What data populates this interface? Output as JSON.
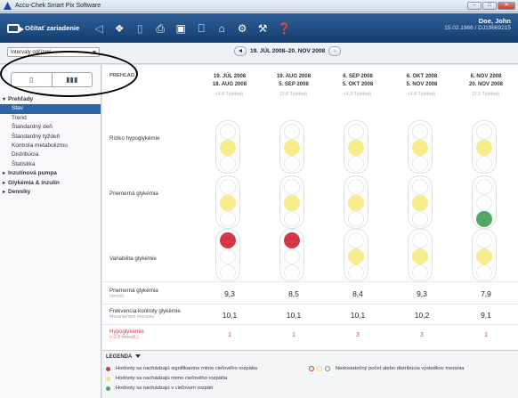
{
  "window": {
    "title": "Accu-Chek Smart Pix Software",
    "controls": [
      "–",
      "□",
      "✕"
    ]
  },
  "toolbar": {
    "read_label": "Očítať zariadenie",
    "icons": [
      "◁",
      "❖",
      "▯",
      "⎙",
      "▣",
      "⎕",
      "⌂",
      "⚙",
      "⚒",
      "❓"
    ]
  },
  "user": {
    "name": "Doe, John",
    "dob_id": "15.02.1966 / DJ19669215"
  },
  "subbar": {
    "interval_select": "Intervaly odčítaní",
    "date_range": "19. JÚL 2008–20. NOV 2008"
  },
  "view_toggle": {
    "left": "▯",
    "right": "▮▮▮"
  },
  "sidebar": {
    "items": [
      {
        "label": "Prehľady",
        "type": "group-open"
      },
      {
        "label": "Stav",
        "type": "item",
        "selected": true
      },
      {
        "label": "Trend",
        "type": "item"
      },
      {
        "label": "Štandardný deň",
        "type": "item"
      },
      {
        "label": "Štandardný týždeň",
        "type": "item"
      },
      {
        "label": "Kontrola metabolizmu",
        "type": "item"
      },
      {
        "label": "Distribúcia",
        "type": "item"
      },
      {
        "label": "Štatistika",
        "type": "item"
      },
      {
        "label": "Inzulínová pumpa",
        "type": "group"
      },
      {
        "label": "Glykémia & inzulín",
        "type": "group"
      },
      {
        "label": "Denníky",
        "type": "group-plain"
      }
    ]
  },
  "table": {
    "header_label": "PREHĽAD",
    "periods": [
      {
        "start": "19. JÚL 2008",
        "end": "18. AUG 2008",
        "weeks": "(4,4 Týždne)"
      },
      {
        "start": "19. AUG 2008",
        "end": "5. SEP 2008",
        "weeks": "(2,6 Týždne)"
      },
      {
        "start": "6. SEP 2008",
        "end": "5. OKT 2008",
        "weeks": "(4,3 Týždne)"
      },
      {
        "start": "6. OKT 2008",
        "end": "5. NOV 2008",
        "weeks": "(4,4 Týždne)"
      },
      {
        "start": "6. NOV 2008",
        "end": "20. NOV 2008",
        "weeks": "(2,1 Týždne)"
      }
    ],
    "rows": {
      "hypo_risk": {
        "label": "Riziko hypoglykémie",
        "lights": [
          "yellow",
          "yellow",
          "yellow",
          "yellow",
          "yellow"
        ]
      },
      "avg_glycemia": {
        "label": "Priemerná glykémia",
        "lights": [
          "yellow",
          "yellow",
          "yellow",
          "yellow",
          "green"
        ]
      },
      "variability": {
        "label": "Variabilita glykémie",
        "lights": [
          "red",
          "red",
          "yellow",
          "yellow",
          "yellow"
        ]
      }
    },
    "metrics": {
      "avg": {
        "label": "Priemerná glykémia",
        "unit": "mmol/L",
        "values": [
          "9,3",
          "8,5",
          "8,4",
          "9,3",
          "7,9"
        ]
      },
      "freq": {
        "label": "Frekvencia kontroly glykémie",
        "unit": "Meranie/deň merania",
        "values": [
          "10,1",
          "10,1",
          "10,1",
          "10,2",
          "9,1"
        ]
      },
      "hypo": {
        "label": "Hypoglykémie",
        "unit": "(<2,8 mmol/L)",
        "values": [
          "1",
          "1",
          "3",
          "3",
          "1"
        ]
      }
    }
  },
  "legend": {
    "title": "LEGENDA",
    "red": "Hodnoty sa nachádzajú signifikantne mimo cieľového rozpätia",
    "yellow": "Hodnoty sa nachádzajú mimo cieľového rozpätia",
    "green": "Hodnoty sa nachádzajú v cieľovom rozpätí",
    "insufficient": "Nedostatočný počet alebo distribúcia výsledkov merania"
  },
  "colors": {
    "red": "#d23845",
    "yellow": "#f8ec8a",
    "green": "#4fa866",
    "accent": "#2d66a8",
    "toolbar": "#1f4a80"
  }
}
